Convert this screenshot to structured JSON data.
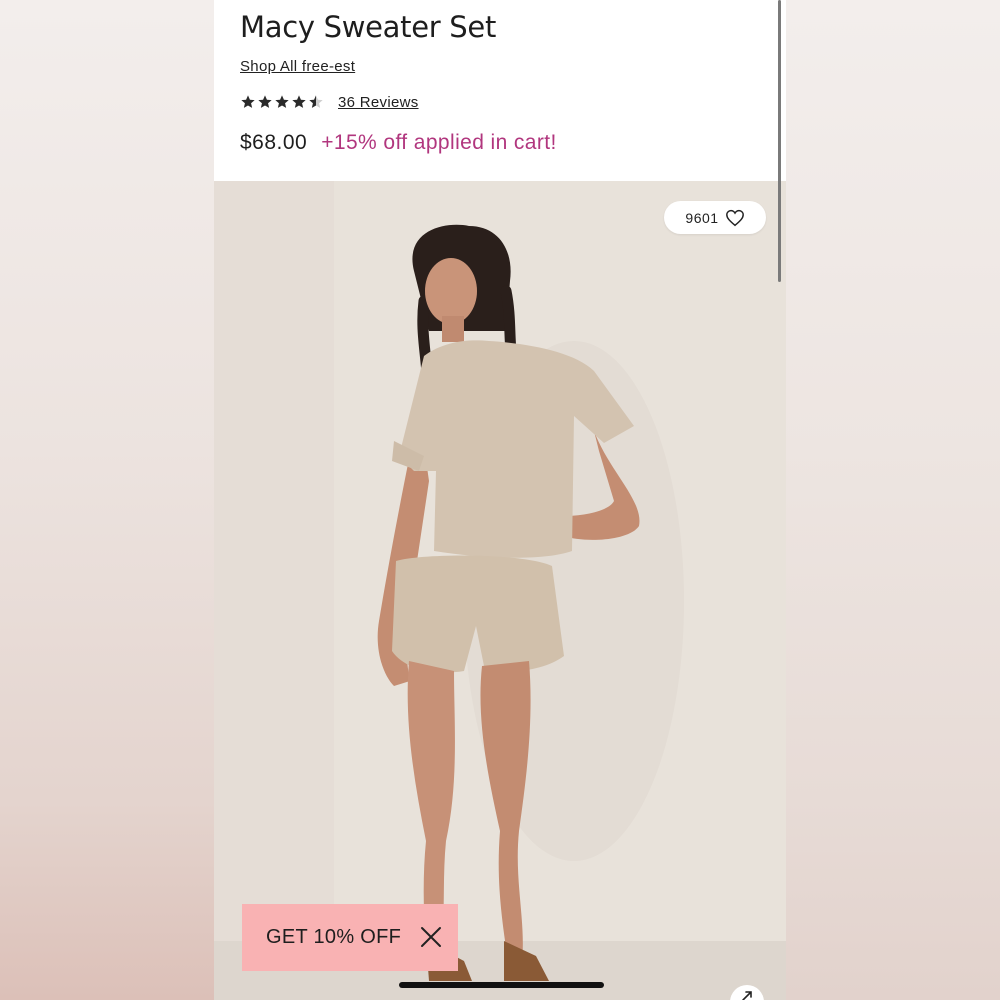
{
  "product": {
    "title": "Macy Sweater Set",
    "shop_link": "Shop All free-est",
    "rating": 4.5,
    "rating_max": 5,
    "reviews_label": "36 Reviews",
    "price": "$68.00",
    "promo_text": "+15% off applied in cart!"
  },
  "favorites": {
    "count": "9601",
    "icon": "heart-icon"
  },
  "promo_banner": {
    "label": "GET 10% OFF",
    "close_icon": "close-icon"
  },
  "colors": {
    "promo_text": "#b1367e",
    "banner_bg": "#f9b2b3",
    "text": "#1e1e1e"
  }
}
